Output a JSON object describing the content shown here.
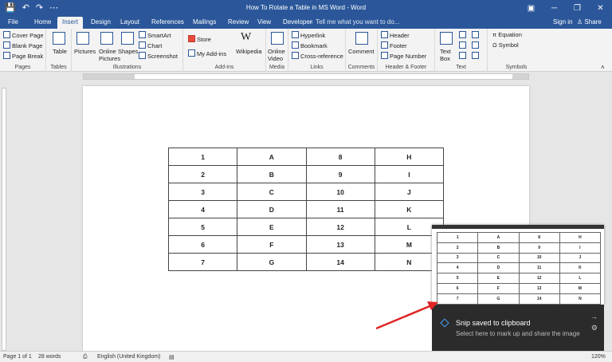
{
  "app": {
    "title": "How To Rotate a Table in MS Word - Word",
    "qat": {
      "save": "💾",
      "undo": "↶",
      "redo": "↷",
      "more": "⋯"
    },
    "window_controls": {
      "ribbon_display": "▣",
      "minimize": "─",
      "restore": "❐",
      "close": "✕"
    }
  },
  "tabs": [
    {
      "label": "File"
    },
    {
      "label": "Home"
    },
    {
      "label": "Insert"
    },
    {
      "label": "Design"
    },
    {
      "label": "Layout"
    },
    {
      "label": "References"
    },
    {
      "label": "Mailings"
    },
    {
      "label": "Review"
    },
    {
      "label": "View"
    },
    {
      "label": "Developer"
    }
  ],
  "tell_me": "Tell me what you want to do...",
  "sign_in": "Sign in",
  "share": "Share",
  "ribbon": {
    "pages": {
      "label": "Pages",
      "cover_page": "Cover Page",
      "blank_page": "Blank Page",
      "page_break": "Page Break"
    },
    "tables": {
      "label": "Tables",
      "table": "Table"
    },
    "illustrations": {
      "label": "Illustrations",
      "pictures": "Pictures",
      "online_pictures_1": "Online",
      "online_pictures_2": "Pictures",
      "shapes": "Shapes",
      "smartart": "SmartArt",
      "chart": "Chart",
      "screenshot": "Screenshot"
    },
    "addins": {
      "label": "Add-ins",
      "store": "Store",
      "my_addins": "My Add-ins",
      "wikipedia": "Wikipedia"
    },
    "media": {
      "label": "Media",
      "online_video_1": "Online",
      "online_video_2": "Video"
    },
    "links": {
      "label": "Links",
      "hyperlink": "Hyperlink",
      "bookmark": "Bookmark",
      "cross_reference": "Cross-reference"
    },
    "comments": {
      "label": "Comments",
      "comment": "Comment"
    },
    "header_footer": {
      "label": "Header & Footer",
      "header": "Header",
      "footer": "Footer",
      "page_number": "Page Number"
    },
    "text": {
      "label": "Text",
      "text_box_1": "Text",
      "text_box_2": "Box"
    },
    "symbols": {
      "label": "Symbols",
      "equation": "Equation",
      "symbol": "Symbol"
    }
  },
  "document_table": [
    [
      "1",
      "A",
      "8",
      "H"
    ],
    [
      "2",
      "B",
      "9",
      "I"
    ],
    [
      "3",
      "C",
      "10",
      "J"
    ],
    [
      "4",
      "D",
      "11",
      "K"
    ],
    [
      "5",
      "E",
      "12",
      "L"
    ],
    [
      "6",
      "F",
      "13",
      "M"
    ],
    [
      "7",
      "G",
      "14",
      "N"
    ]
  ],
  "status": {
    "page": "Page 1 of 1",
    "words": "28 words",
    "language": "English (United Kingdom)",
    "zoom": "120%"
  },
  "toast": {
    "title": "Snip saved to clipboard",
    "message": "Select here to mark up and share the image"
  }
}
